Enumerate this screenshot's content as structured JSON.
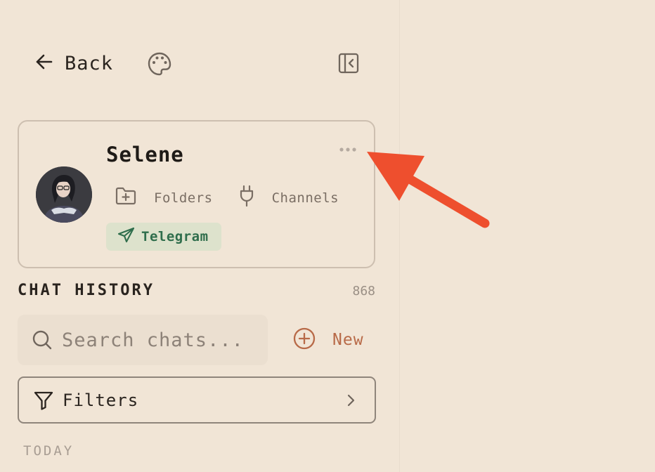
{
  "header": {
    "back_label": "Back",
    "icons": [
      "arrow-left-icon",
      "palette-icon",
      "sidebar-collapse-icon"
    ]
  },
  "profile": {
    "name": "Selene",
    "folders_label": "Folders",
    "channels_label": "Channels",
    "telegram_label": "Telegram"
  },
  "history": {
    "title": "CHAT HISTORY",
    "count": "868",
    "search_placeholder": "Search chats...",
    "new_label": "New",
    "filters_label": "Filters",
    "today_label": "TODAY"
  },
  "colors": {
    "background": "#f1e5d6",
    "accent": "#b86a48",
    "telegram_bg": "#dde2cc",
    "telegram_text": "#2f6e4c",
    "annotation_arrow": "#ee4f2e"
  }
}
